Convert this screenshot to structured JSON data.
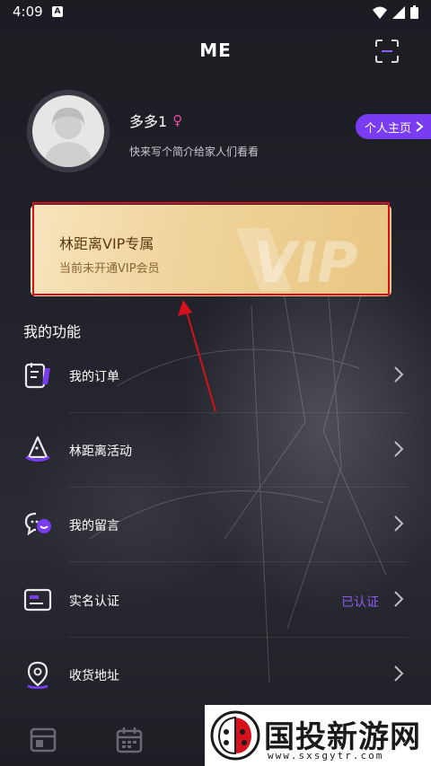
{
  "status_bar": {
    "time": "4:09",
    "notification_letter": "A"
  },
  "header": {
    "title": "ME",
    "scan_icon": "scan-icon"
  },
  "profile": {
    "name": "多多1",
    "gender_symbol": "♀",
    "bio": "快来写个简介给家人们看看",
    "homepage_button": "个人主页"
  },
  "vip": {
    "title": "林距离VIP专属",
    "subtitle": "当前未开通VIP会员"
  },
  "functions": {
    "section_title": "我的功能",
    "items": [
      {
        "label": "我的订单",
        "icon": "order-list-icon",
        "status": ""
      },
      {
        "label": "林距离活动",
        "icon": "witch-hat-icon",
        "status": ""
      },
      {
        "label": "我的留言",
        "icon": "message-bubble-icon",
        "status": ""
      },
      {
        "label": "实名认证",
        "icon": "id-card-icon",
        "status": "已认证"
      },
      {
        "label": "收货地址",
        "icon": "location-pin-icon",
        "status": ""
      }
    ]
  },
  "watermark": {
    "text": "国投新游网",
    "url": "www.sxsgytr.com"
  },
  "colors": {
    "accent": "#7a3cf0",
    "status_purple": "#8b5cf6",
    "gender_pink": "#e84aa2",
    "highlight_red": "#d4111c"
  }
}
